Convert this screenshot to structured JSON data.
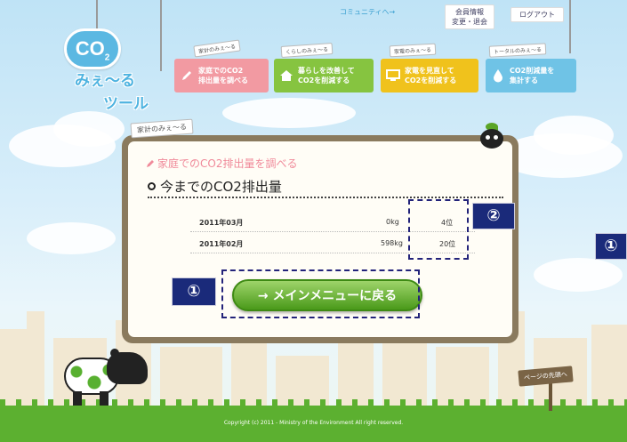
{
  "header": {
    "community_link": "コミュニティへ→",
    "member_info_line1": "会員情報",
    "member_info_line2": "変更・退会",
    "logout": "ログアウト"
  },
  "logo": {
    "co2": "CO",
    "co2_sub": "2",
    "line1": "みぇ〜る",
    "line2": "ツール"
  },
  "nav": [
    {
      "tag": "家計のみぇ〜る",
      "label1": "家庭でのCO2",
      "label2": "排出量を調べる",
      "color": "#f29aa2",
      "icon": "pencil-icon"
    },
    {
      "tag": "くらしのみぇ〜る",
      "label1": "暮らしを改善して",
      "label2": "CO2を削減する",
      "color": "#86c440",
      "icon": "house-icon"
    },
    {
      "tag": "家電のみぇ〜る",
      "label1": "家電を見直して",
      "label2": "CO2を削減する",
      "color": "#f0c21c",
      "icon": "monitor-icon"
    },
    {
      "tag": "トータルのみぇ〜る",
      "label1": "CO2削減量を",
      "label2": "集計する",
      "color": "#6fc3e6",
      "icon": "drop-icon"
    }
  ],
  "panel": {
    "tag": "家計のみぇ〜る",
    "section_title": "家庭でのCO2排出量を調べる",
    "heading": "今までのCO2排出量",
    "rows": [
      {
        "month": "2011年03月",
        "amount": "0kg",
        "rank": "4位"
      },
      {
        "month": "2011年02月",
        "amount": "598kg",
        "rank": "20位"
      }
    ],
    "back_button": "→ メインメニューに戻る"
  },
  "annotations": {
    "marker1": "①",
    "marker2": "②",
    "marker1_right": "①"
  },
  "footer": {
    "page_top": "ページの先頭へ",
    "copyright": "Copyright (c) 2011 - Ministry of the Environment All right reserved."
  },
  "colors": {
    "panel_border": "#8a7a5e",
    "button_green": "#4a9a1a",
    "annotation_navy": "#1a2a7a",
    "ground_green": "#5cb030"
  }
}
